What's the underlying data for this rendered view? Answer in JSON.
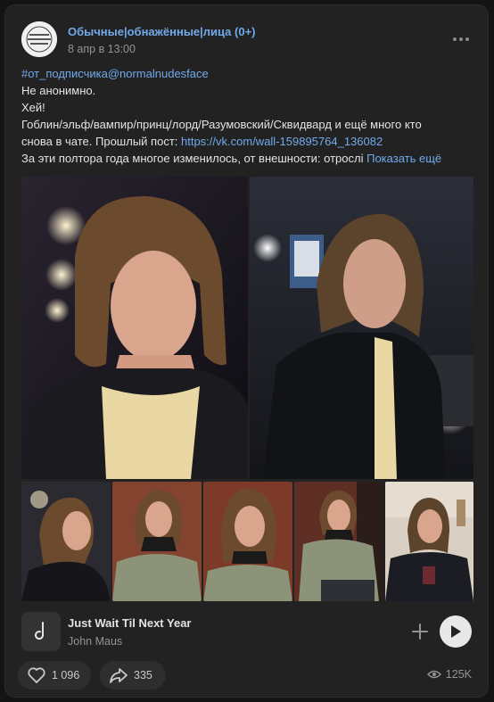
{
  "post": {
    "group_name": "Обычные|обнажённые|лица (0+)",
    "date": "8 апр в 13:00",
    "text": {
      "hashtag": "#от_подписчика@normalnudesface",
      "line2": "Не анонимно.",
      "line3": "Хей!",
      "line4": "Гоблин/эльф/вампир/принц/лорд/Разумовский/Сквидвард и ещё много кто",
      "line5_prefix": "снова в чате. Прошлый пост: ",
      "line5_link": "https://vk.com/wall-159895764_136082",
      "line6": "За эти полтора года многое изменилось, от внешности: отрослі",
      "show_more": "Показать ещё"
    }
  },
  "audio": {
    "title": "Just Wait Til Next Year",
    "artist": "John Maus"
  },
  "actions": {
    "likes": "1 096",
    "shares": "335",
    "views": "125K"
  },
  "icons": {
    "more": "more-dots-icon",
    "note": "music-note-icon",
    "add": "plus-icon",
    "play": "play-icon",
    "like": "heart-icon",
    "share": "share-arrow-icon",
    "views": "eye-icon"
  },
  "colors": {
    "link": "#71aaeb",
    "card_bg": "#222222",
    "page_bg": "#141414"
  }
}
